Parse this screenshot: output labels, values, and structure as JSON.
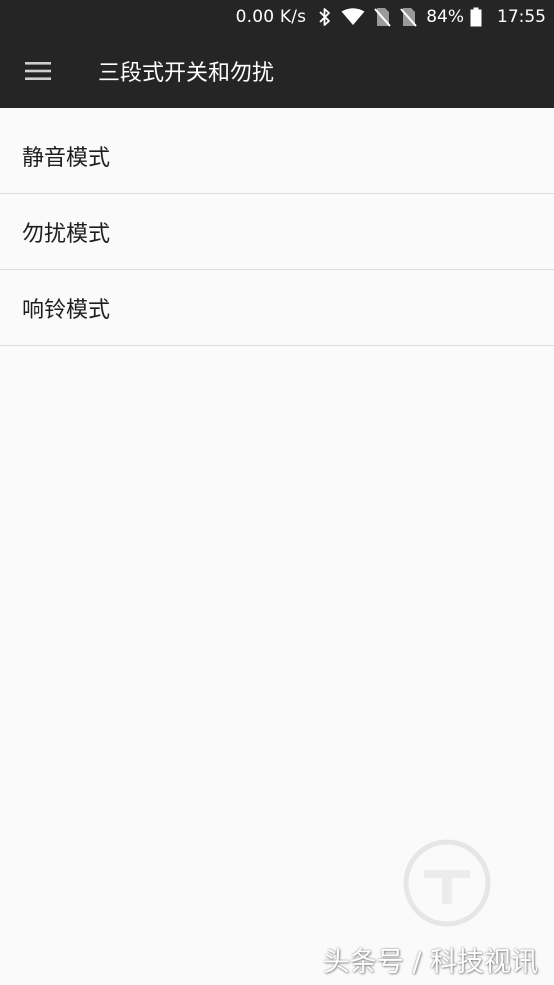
{
  "status_bar": {
    "network_speed": "0.00 K/s",
    "battery_percent": "84%",
    "time": "17:55",
    "icons": [
      "bluetooth-icon",
      "wifi-icon",
      "no-sim-icon",
      "no-sim-icon",
      "battery-icon"
    ]
  },
  "app_bar": {
    "menu_icon": "hamburger-menu-icon",
    "title": "三段式开关和勿扰"
  },
  "modes": [
    {
      "label": "静音模式"
    },
    {
      "label": "勿扰模式"
    },
    {
      "label": "响铃模式"
    }
  ],
  "watermark": {
    "text": "头条号 / 科技视讯"
  },
  "colors": {
    "bar_background": "#252525",
    "page_background": "#fafafa",
    "divider": "#dcdcdc",
    "text_primary": "#1e1e1e"
  }
}
